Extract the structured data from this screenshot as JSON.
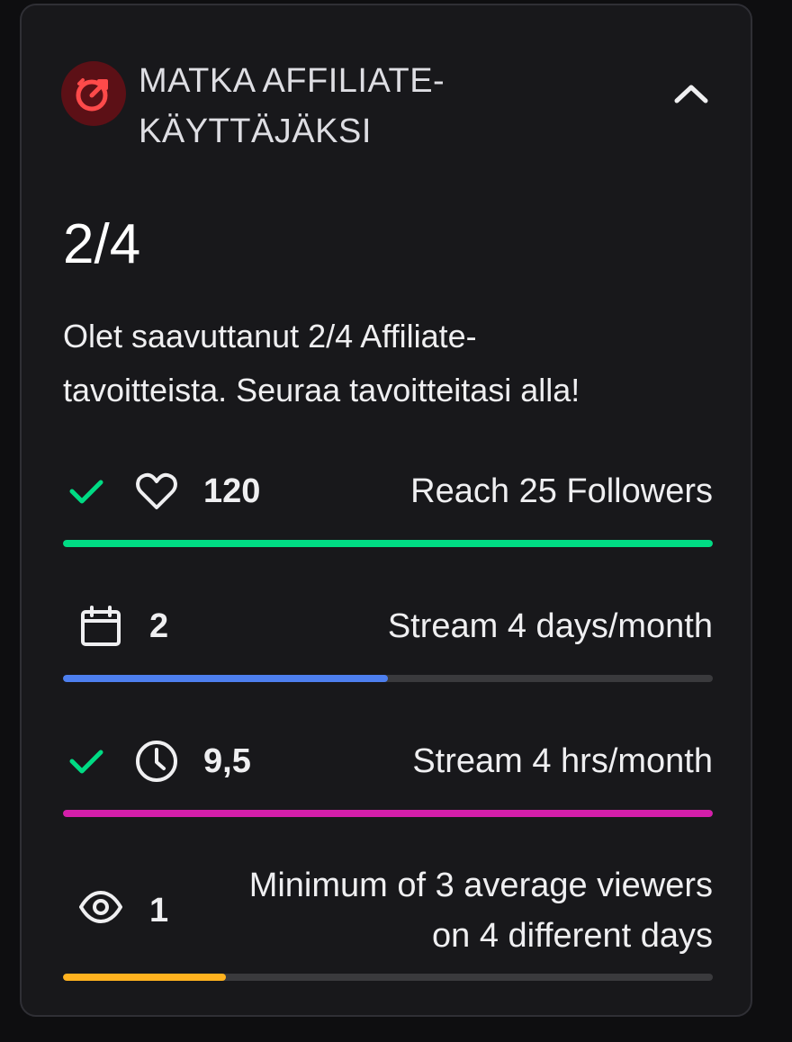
{
  "header": {
    "title_line1": "MATKA AFFILIATE-",
    "title_line2": "KÄYTTÄJÄKSI",
    "badge_icon": "target-arrow-icon",
    "collapse_icon": "chevron-up-icon"
  },
  "summary": {
    "count": "2/4",
    "description_line1": "Olet saavuttanut 2/4 Affiliate-",
    "description_line2": "tavoitteista. Seuraa tavoitteitasi alla!"
  },
  "goals": [
    {
      "icon": "heart-icon",
      "completed": true,
      "value": "120",
      "label": "Reach 25 Followers",
      "progress": 1.0,
      "color": "#00db84"
    },
    {
      "icon": "calendar-icon",
      "completed": false,
      "value": "2",
      "label": "Stream 4 days/month",
      "progress": 0.5,
      "color": "#4d7fef"
    },
    {
      "icon": "clock-icon",
      "completed": true,
      "value": "9,5",
      "label": "Stream 4 hrs/month",
      "progress": 1.0,
      "color": "#d41eaa"
    },
    {
      "icon": "eye-icon",
      "completed": false,
      "value": "1",
      "label_line1": "Minimum of 3 average viewers",
      "label_line2": "on 4 different days",
      "progress": 0.25,
      "color": "#ffb21f"
    }
  ],
  "colors": {
    "check": "#00db84",
    "badge_bg": "#5c1016",
    "badge_fg": "#ff4a4a",
    "track": "#3a3a3d"
  }
}
